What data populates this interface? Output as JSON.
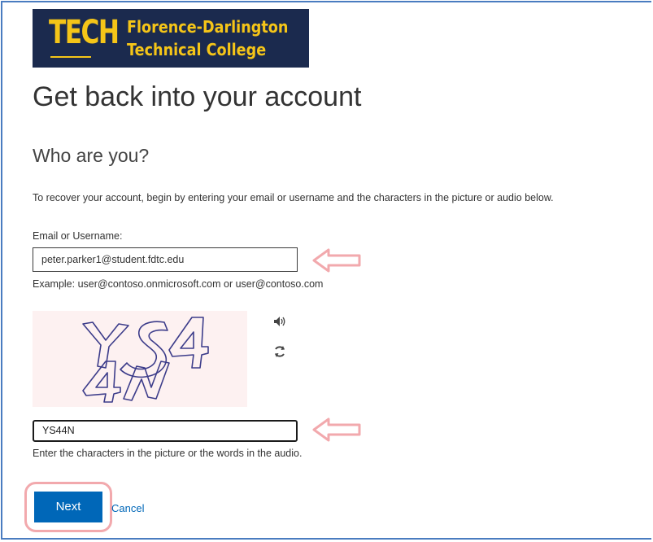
{
  "logo": {
    "tech": "TECH",
    "line1": "Florence-Darlington",
    "line2": "Technical College"
  },
  "page": {
    "title": "Get back into your account",
    "subtitle": "Who are you?",
    "intro": "To recover your account, begin by entering your email or username and the characters in the picture or audio below."
  },
  "email": {
    "label": "Email or Username:",
    "value": "peter.parker1@student.fdtc.edu",
    "example": "Example: user@contoso.onmicrosoft.com or user@contoso.com"
  },
  "captcha": {
    "image_text": "YS44N",
    "input_value": "YS44N",
    "hint": "Enter the characters in the picture or the words in the audio."
  },
  "actions": {
    "next_label": "Next",
    "cancel_label": "Cancel"
  },
  "icons": {
    "audio": "speaker-icon",
    "refresh": "refresh-icon"
  },
  "colors": {
    "brand_navy": "#1b2a4e",
    "brand_gold": "#f5c518",
    "primary_blue": "#0067b8",
    "annotation_pink": "#f2a9ad",
    "captcha_bg": "#fdf1f1",
    "captcha_ink": "#3c3c8a"
  }
}
